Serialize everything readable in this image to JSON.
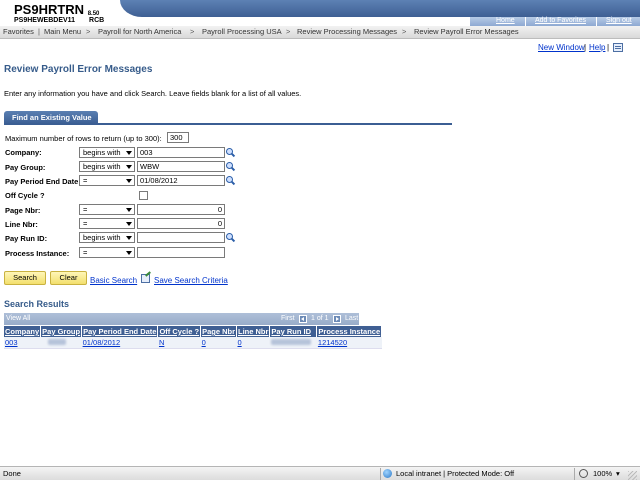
{
  "banner": {
    "system_name": "PS9HRTRN",
    "version": "8.50",
    "database": "PS9HEWEBDEV11",
    "user": "RCB",
    "links": [
      "Home",
      "Add to Favorites",
      "Sign out"
    ]
  },
  "breadcrumbs": [
    "Favorites",
    "Main Menu",
    "Payroll for North America",
    "Payroll Processing USA",
    "Review Processing Messages",
    "Review Payroll Error Messages"
  ],
  "top_links": {
    "new_window": "New Window",
    "help": "Help"
  },
  "page": {
    "title": "Review Payroll Error Messages",
    "instructions": "Enter any information you have and click Search. Leave fields blank for a list of all values.",
    "tab": "Find an Existing Value"
  },
  "form": {
    "max_rows_label": "Maximum number of rows to return (up to 300):",
    "max_rows_value": "300",
    "fields": [
      {
        "label": "Company:",
        "operator": "begins with",
        "value": ""
      },
      {
        "label": "Pay Group:",
        "operator": "begins with",
        "value": "WBW"
      },
      {
        "label": "Pay Period End Date:",
        "operator": "=",
        "value": "01/08/2012"
      },
      {
        "label": "Off Cycle ?",
        "operator": "",
        "value": ""
      },
      {
        "label": "Page Nbr:",
        "operator": "=",
        "value": "0"
      },
      {
        "label": "Line Nbr:",
        "operator": "=",
        "value": "0"
      },
      {
        "label": "Pay Run ID:",
        "operator": "begins with",
        "value": ""
      },
      {
        "label": "Process Instance:",
        "operator": "=",
        "value": ""
      }
    ],
    "company_value": "003"
  },
  "buttons": {
    "search": "Search",
    "clear": "Clear",
    "basic_search": "Basic Search",
    "save_search": "Save Search Criteria"
  },
  "results": {
    "heading": "Search Results",
    "view_all": "View All",
    "first": "First",
    "range": "1 of 1",
    "last": "Last",
    "columns": [
      "Company",
      "Pay Group",
      "Pay Period End Date",
      "Off Cycle ?",
      "Page Nbr",
      "Line Nbr",
      "Pay Run ID",
      "Process Instance"
    ],
    "rows": [
      {
        "company": "003",
        "pay_group": "",
        "end_date": "01/08/2012",
        "off_cycle": "N",
        "page_nbr": "0",
        "line_nbr": "0",
        "pay_run_id": "",
        "process_instance": "1214520"
      }
    ]
  },
  "status": {
    "left": "Done",
    "zone": "Local intranet | Protected Mode: Off",
    "zoom": "100%"
  }
}
